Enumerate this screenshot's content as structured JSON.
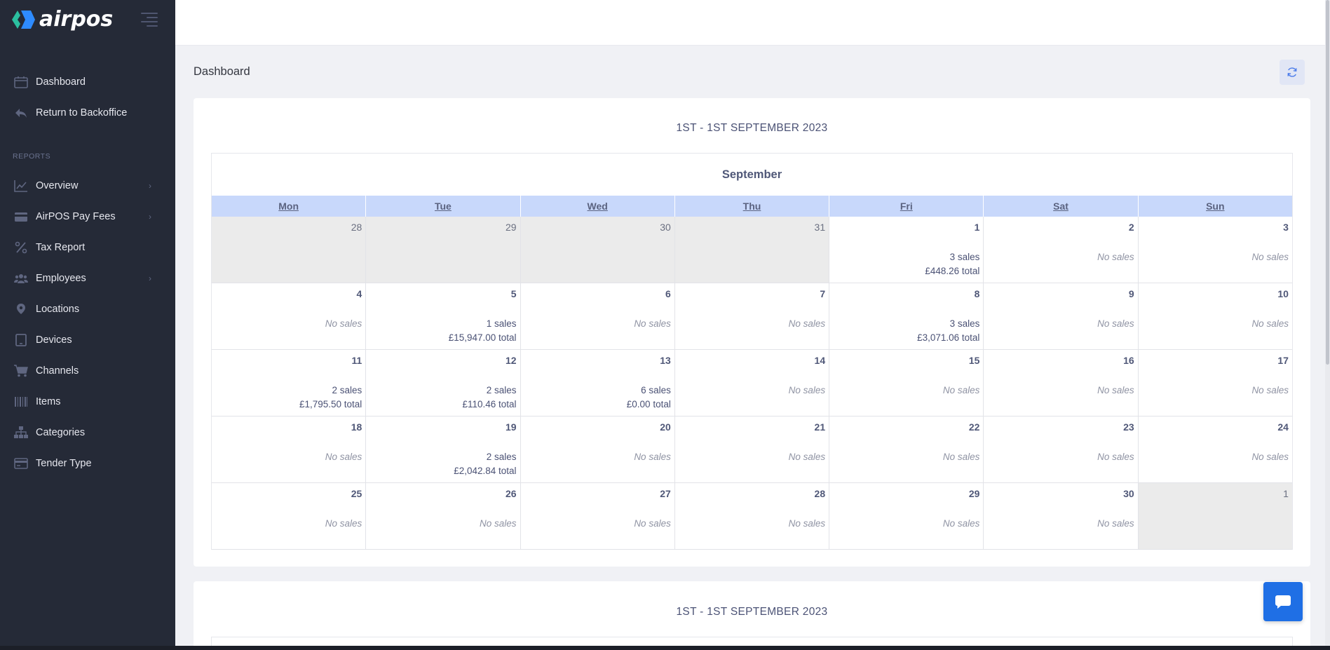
{
  "brand": {
    "name": "airpos",
    "colors": {
      "mark_left": "#2bbf9f",
      "mark_right": "#2e8bff"
    }
  },
  "sidebar": {
    "top_items": [
      {
        "label": "Dashboard",
        "icon": "calendar-icon"
      },
      {
        "label": "Return to Backoffice",
        "icon": "reply-arrow-icon"
      }
    ],
    "section_label": "REPORTS",
    "report_items": [
      {
        "label": "Overview",
        "icon": "line-chart-icon",
        "has_submenu": true
      },
      {
        "label": "AirPOS Pay Fees",
        "icon": "credit-card-icon",
        "has_submenu": true
      },
      {
        "label": "Tax Report",
        "icon": "percent-icon",
        "has_submenu": false
      },
      {
        "label": "Employees",
        "icon": "users-icon",
        "has_submenu": true
      },
      {
        "label": "Locations",
        "icon": "map-pin-icon",
        "has_submenu": false
      },
      {
        "label": "Devices",
        "icon": "tablet-icon",
        "has_submenu": false
      },
      {
        "label": "Channels",
        "icon": "cart-icon",
        "has_submenu": false
      },
      {
        "label": "Items",
        "icon": "barcode-icon",
        "has_submenu": false
      },
      {
        "label": "Categories",
        "icon": "sitemap-icon",
        "has_submenu": false
      },
      {
        "label": "Tender Type",
        "icon": "card-icon",
        "has_submenu": false
      }
    ]
  },
  "page": {
    "title": "Dashboard",
    "refresh_icon": "refresh-icon"
  },
  "calendar_card": {
    "title": "1ST - 1ST SEPTEMBER 2023",
    "month": "September",
    "weekdays": [
      "Mon",
      "Tue",
      "Wed",
      "Thu",
      "Fri",
      "Sat",
      "Sun"
    ],
    "weeks": [
      [
        {
          "day": "28",
          "other": true
        },
        {
          "day": "29",
          "other": true
        },
        {
          "day": "30",
          "other": true
        },
        {
          "day": "31",
          "other": true
        },
        {
          "day": "1",
          "sales": "3 sales",
          "total": "£448.26 total"
        },
        {
          "day": "2",
          "none": "No sales"
        },
        {
          "day": "3",
          "none": "No sales"
        }
      ],
      [
        {
          "day": "4",
          "none": "No sales"
        },
        {
          "day": "5",
          "sales": "1 sales",
          "total": "£15,947.00 total"
        },
        {
          "day": "6",
          "none": "No sales"
        },
        {
          "day": "7",
          "none": "No sales"
        },
        {
          "day": "8",
          "sales": "3 sales",
          "total": "£3,071.06 total"
        },
        {
          "day": "9",
          "none": "No sales"
        },
        {
          "day": "10",
          "none": "No sales"
        }
      ],
      [
        {
          "day": "11",
          "sales": "2 sales",
          "total": "£1,795.50 total"
        },
        {
          "day": "12",
          "sales": "2 sales",
          "total": "£110.46 total"
        },
        {
          "day": "13",
          "sales": "6 sales",
          "total": "£0.00 total"
        },
        {
          "day": "14",
          "none": "No sales"
        },
        {
          "day": "15",
          "none": "No sales"
        },
        {
          "day": "16",
          "none": "No sales"
        },
        {
          "day": "17",
          "none": "No sales"
        }
      ],
      [
        {
          "day": "18",
          "none": "No sales"
        },
        {
          "day": "19",
          "sales": "2 sales",
          "total": "£2,042.84 total"
        },
        {
          "day": "20",
          "none": "No sales"
        },
        {
          "day": "21",
          "none": "No sales"
        },
        {
          "day": "22",
          "none": "No sales"
        },
        {
          "day": "23",
          "none": "No sales"
        },
        {
          "day": "24",
          "none": "No sales"
        }
      ],
      [
        {
          "day": "25",
          "none": "No sales"
        },
        {
          "day": "26",
          "none": "No sales"
        },
        {
          "day": "27",
          "none": "No sales"
        },
        {
          "day": "28",
          "none": "No sales"
        },
        {
          "day": "29",
          "none": "No sales"
        },
        {
          "day": "30",
          "none": "No sales"
        },
        {
          "day": "1",
          "other": true
        }
      ]
    ]
  },
  "second_card": {
    "title": "1ST - 1ST SEPTEMBER 2023"
  },
  "chat": {
    "icon": "chat-bubble-icon",
    "color": "#1f6fe5"
  }
}
